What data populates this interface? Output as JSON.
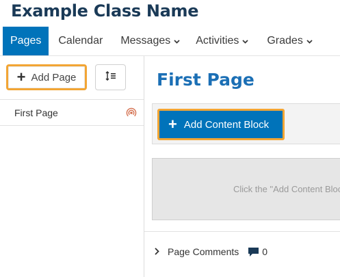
{
  "header": {
    "class_name": "Example Class Name"
  },
  "nav": {
    "items": [
      {
        "label": "Pages",
        "dropdown": false,
        "active": true
      },
      {
        "label": "Calendar",
        "dropdown": false
      },
      {
        "label": "Messages",
        "dropdown": true
      },
      {
        "label": "Activities",
        "dropdown": true
      },
      {
        "label": "Grades",
        "dropdown": true
      }
    ],
    "caret_glyph": "⌄"
  },
  "sidebar": {
    "add_page_label": "Add Page",
    "plus_glyph": "+",
    "pages": [
      {
        "label": "First Page",
        "status_icon": "broadcast-icon"
      }
    ]
  },
  "main": {
    "page_title": "First Page",
    "add_block_label": "Add Content Block",
    "drop_hint": "Click the \"Add Content Block\" button above to add content to this page.",
    "comments_label": "Page Comments",
    "comments_count": "0",
    "chevron_glyph": ">"
  },
  "colors": {
    "brand_blue": "#0073ba",
    "title_navy": "#1a3a57",
    "highlight_orange": "#f2a534",
    "heading_blue": "#1b6fb5"
  }
}
